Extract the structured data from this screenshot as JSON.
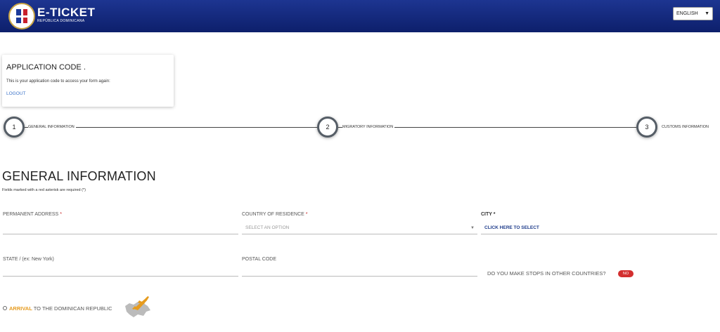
{
  "header": {
    "brand_title": "E-TICKET",
    "brand_subtitle": "REPÚBLICA DOMINICANA",
    "language": "ENGLISH",
    "bar_color": "#0d1f6b"
  },
  "code_card": {
    "title": "APPLICATION CODE .",
    "description": "This is your application code to access your form again:",
    "logout": "LOGOUT"
  },
  "stepper": {
    "steps": [
      {
        "number": "1",
        "label": "GENERAL INFORMATION"
      },
      {
        "number": "2",
        "label": "MIGRATORY INFORMATION"
      },
      {
        "number": "3",
        "label": "CUSTOMS INFORMATION"
      }
    ]
  },
  "form": {
    "title": "GENERAL INFORMATION",
    "note": "Fields marked with a red asterisk are required (*)",
    "permanent_address_label": "PERMANENT ADDRESS",
    "country_label": "COUNTRY OF RESIDENCE",
    "country_placeholder": "SELECT AN OPTION",
    "city_label": "CITY",
    "city_link": "CLICK HERE TO SELECT",
    "state_label": "STATE / (ex: New York)",
    "postal_label": "POSTAL CODE",
    "stops_label": "DO YOU MAKE STOPS IN OTHER COUNTRIES?",
    "stops_toggle": "NO",
    "required_mark": "*",
    "arrival_highlight": "ARRIVAL",
    "arrival_rest": " TO THE DOMINICAN REPUBLIC"
  },
  "colors": {
    "accent_link": "#3a72c8",
    "toggle_off": "#d32f2f",
    "arrival_orange": "#e69b1e"
  }
}
